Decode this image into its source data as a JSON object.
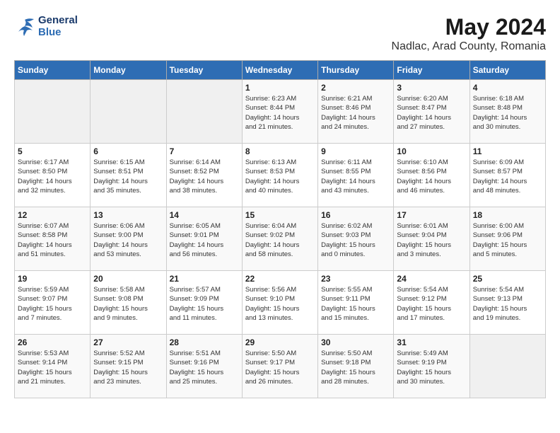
{
  "header": {
    "logo_line1": "General",
    "logo_line2": "Blue",
    "month": "May 2024",
    "location": "Nadlac, Arad County, Romania"
  },
  "days_of_week": [
    "Sunday",
    "Monday",
    "Tuesday",
    "Wednesday",
    "Thursday",
    "Friday",
    "Saturday"
  ],
  "weeks": [
    [
      {
        "num": "",
        "info": ""
      },
      {
        "num": "",
        "info": ""
      },
      {
        "num": "",
        "info": ""
      },
      {
        "num": "1",
        "info": "Sunrise: 6:23 AM\nSunset: 8:44 PM\nDaylight: 14 hours\nand 21 minutes."
      },
      {
        "num": "2",
        "info": "Sunrise: 6:21 AM\nSunset: 8:46 PM\nDaylight: 14 hours\nand 24 minutes."
      },
      {
        "num": "3",
        "info": "Sunrise: 6:20 AM\nSunset: 8:47 PM\nDaylight: 14 hours\nand 27 minutes."
      },
      {
        "num": "4",
        "info": "Sunrise: 6:18 AM\nSunset: 8:48 PM\nDaylight: 14 hours\nand 30 minutes."
      }
    ],
    [
      {
        "num": "5",
        "info": "Sunrise: 6:17 AM\nSunset: 8:50 PM\nDaylight: 14 hours\nand 32 minutes."
      },
      {
        "num": "6",
        "info": "Sunrise: 6:15 AM\nSunset: 8:51 PM\nDaylight: 14 hours\nand 35 minutes."
      },
      {
        "num": "7",
        "info": "Sunrise: 6:14 AM\nSunset: 8:52 PM\nDaylight: 14 hours\nand 38 minutes."
      },
      {
        "num": "8",
        "info": "Sunrise: 6:13 AM\nSunset: 8:53 PM\nDaylight: 14 hours\nand 40 minutes."
      },
      {
        "num": "9",
        "info": "Sunrise: 6:11 AM\nSunset: 8:55 PM\nDaylight: 14 hours\nand 43 minutes."
      },
      {
        "num": "10",
        "info": "Sunrise: 6:10 AM\nSunset: 8:56 PM\nDaylight: 14 hours\nand 46 minutes."
      },
      {
        "num": "11",
        "info": "Sunrise: 6:09 AM\nSunset: 8:57 PM\nDaylight: 14 hours\nand 48 minutes."
      }
    ],
    [
      {
        "num": "12",
        "info": "Sunrise: 6:07 AM\nSunset: 8:58 PM\nDaylight: 14 hours\nand 51 minutes."
      },
      {
        "num": "13",
        "info": "Sunrise: 6:06 AM\nSunset: 9:00 PM\nDaylight: 14 hours\nand 53 minutes."
      },
      {
        "num": "14",
        "info": "Sunrise: 6:05 AM\nSunset: 9:01 PM\nDaylight: 14 hours\nand 56 minutes."
      },
      {
        "num": "15",
        "info": "Sunrise: 6:04 AM\nSunset: 9:02 PM\nDaylight: 14 hours\nand 58 minutes."
      },
      {
        "num": "16",
        "info": "Sunrise: 6:02 AM\nSunset: 9:03 PM\nDaylight: 15 hours\nand 0 minutes."
      },
      {
        "num": "17",
        "info": "Sunrise: 6:01 AM\nSunset: 9:04 PM\nDaylight: 15 hours\nand 3 minutes."
      },
      {
        "num": "18",
        "info": "Sunrise: 6:00 AM\nSunset: 9:06 PM\nDaylight: 15 hours\nand 5 minutes."
      }
    ],
    [
      {
        "num": "19",
        "info": "Sunrise: 5:59 AM\nSunset: 9:07 PM\nDaylight: 15 hours\nand 7 minutes."
      },
      {
        "num": "20",
        "info": "Sunrise: 5:58 AM\nSunset: 9:08 PM\nDaylight: 15 hours\nand 9 minutes."
      },
      {
        "num": "21",
        "info": "Sunrise: 5:57 AM\nSunset: 9:09 PM\nDaylight: 15 hours\nand 11 minutes."
      },
      {
        "num": "22",
        "info": "Sunrise: 5:56 AM\nSunset: 9:10 PM\nDaylight: 15 hours\nand 13 minutes."
      },
      {
        "num": "23",
        "info": "Sunrise: 5:55 AM\nSunset: 9:11 PM\nDaylight: 15 hours\nand 15 minutes."
      },
      {
        "num": "24",
        "info": "Sunrise: 5:54 AM\nSunset: 9:12 PM\nDaylight: 15 hours\nand 17 minutes."
      },
      {
        "num": "25",
        "info": "Sunrise: 5:54 AM\nSunset: 9:13 PM\nDaylight: 15 hours\nand 19 minutes."
      }
    ],
    [
      {
        "num": "26",
        "info": "Sunrise: 5:53 AM\nSunset: 9:14 PM\nDaylight: 15 hours\nand 21 minutes."
      },
      {
        "num": "27",
        "info": "Sunrise: 5:52 AM\nSunset: 9:15 PM\nDaylight: 15 hours\nand 23 minutes."
      },
      {
        "num": "28",
        "info": "Sunrise: 5:51 AM\nSunset: 9:16 PM\nDaylight: 15 hours\nand 25 minutes."
      },
      {
        "num": "29",
        "info": "Sunrise: 5:50 AM\nSunset: 9:17 PM\nDaylight: 15 hours\nand 26 minutes."
      },
      {
        "num": "30",
        "info": "Sunrise: 5:50 AM\nSunset: 9:18 PM\nDaylight: 15 hours\nand 28 minutes."
      },
      {
        "num": "31",
        "info": "Sunrise: 5:49 AM\nSunset: 9:19 PM\nDaylight: 15 hours\nand 30 minutes."
      },
      {
        "num": "",
        "info": ""
      }
    ]
  ]
}
